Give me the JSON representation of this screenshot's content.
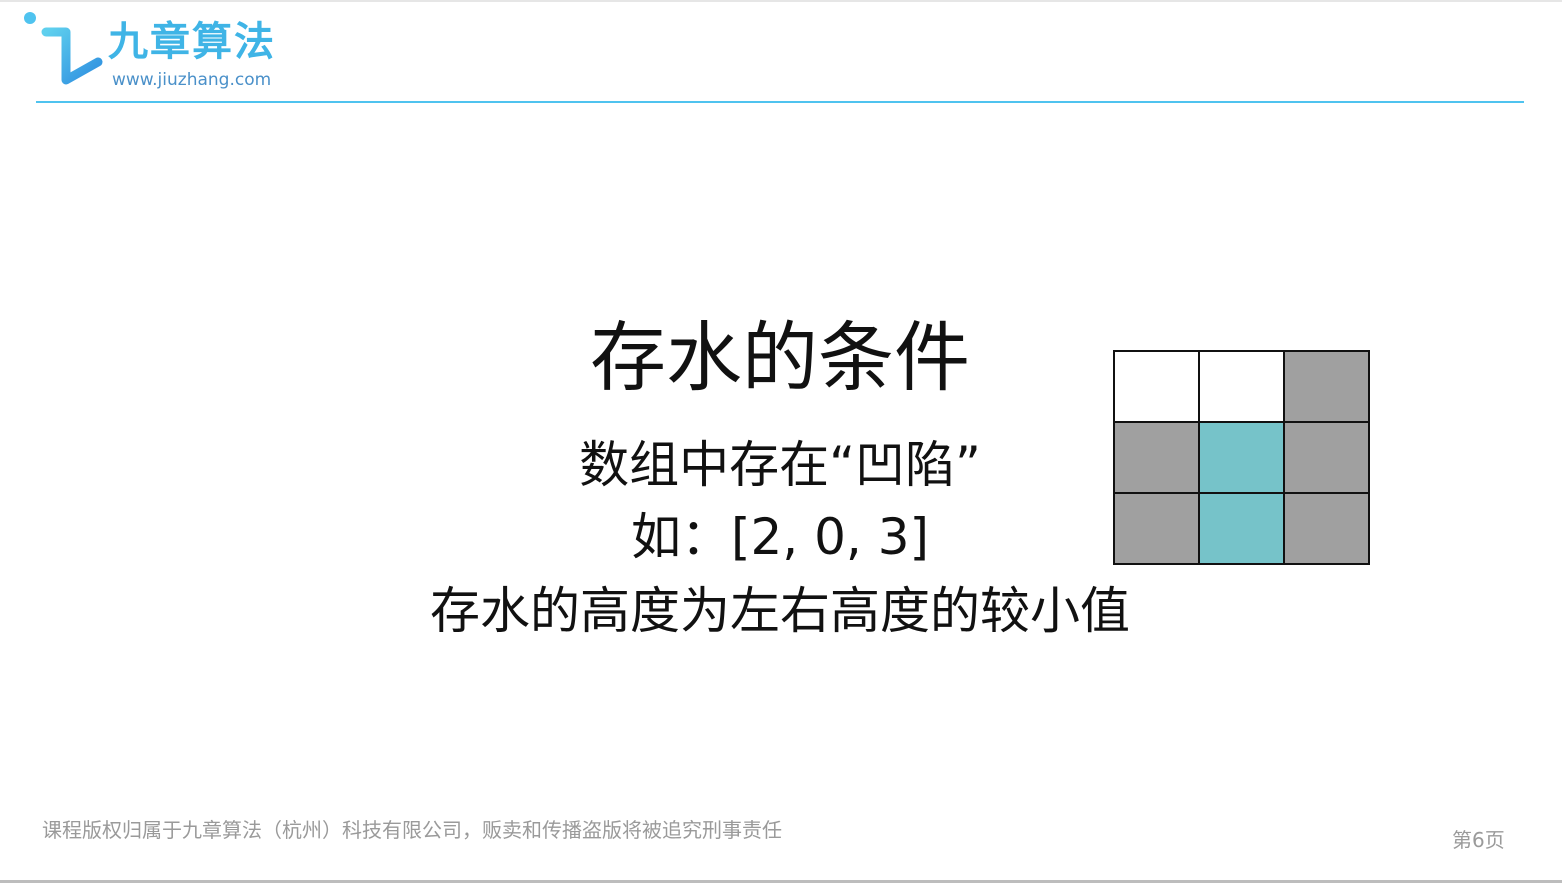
{
  "header": {
    "brand_name": "九章算法",
    "brand_url": "www.jiuzhang.com",
    "brand_color": "#3fb4e6",
    "rule_color": "#4fc3ef"
  },
  "content": {
    "title": "存水的条件",
    "line1": "数组中存在“凹陷”",
    "line2": "如：[2, 0, 3]",
    "line3": "存水的高度为左右高度的较小值"
  },
  "diagram": {
    "columns": 3,
    "rows": 3,
    "heights": [
      2,
      0,
      3
    ],
    "water": [
      0,
      2,
      0
    ],
    "colors": {
      "bar": "#a0a0a0",
      "water": "#76c3c9",
      "empty": "#ffffff",
      "border": "#111111"
    }
  },
  "footer": {
    "copyright": "课程版权归属于九章算法（杭州）科技有限公司，贩卖和传播盗版将被追究刑事责任",
    "page": "第6页"
  }
}
